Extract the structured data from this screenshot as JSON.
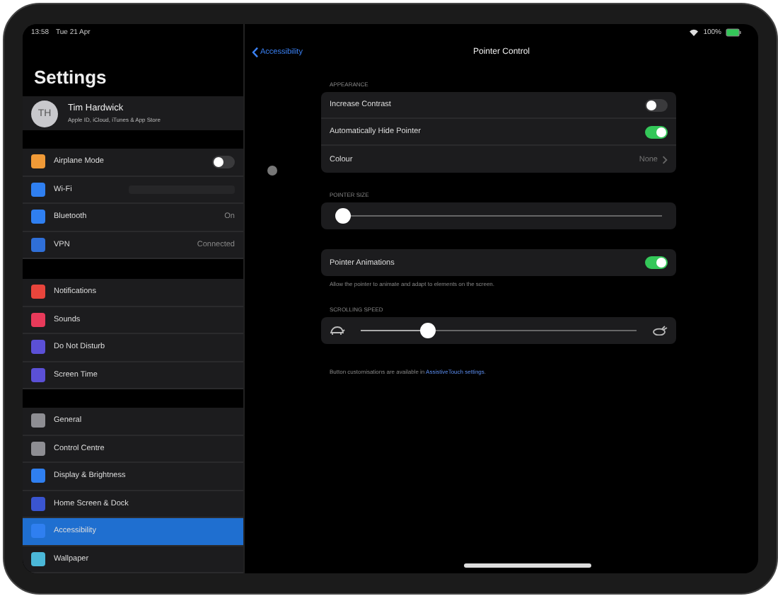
{
  "status_bar": {
    "time": "13:58",
    "date": "Tue 21 Apr",
    "battery": "100%"
  },
  "sidebar": {
    "title": "Settings",
    "profile": {
      "initials": "TH",
      "name": "Tim Hardwick",
      "subtitle": "Apple ID, iCloud, iTunes & App Store"
    },
    "groups": [
      [
        {
          "label": "Airplane Mode",
          "kind": "toggle",
          "on": false,
          "color": "#f09a37",
          "selected": false
        },
        {
          "label": "Wi-Fi",
          "kind": "blurred",
          "color": "#2f7ff0",
          "selected": false
        },
        {
          "label": "Bluetooth",
          "kind": "value",
          "value": "On",
          "color": "#2f7ff0",
          "selected": false
        },
        {
          "label": "VPN",
          "kind": "value",
          "value": "Connected",
          "color": "#2f6fd8",
          "selected": false
        }
      ],
      [
        {
          "label": "Notifications",
          "kind": "plain",
          "color": "#e8453c",
          "selected": false
        },
        {
          "label": "Sounds",
          "kind": "plain",
          "color": "#e83a5a",
          "selected": false
        },
        {
          "label": "Do Not Disturb",
          "kind": "plain",
          "color": "#5b50d6",
          "selected": false
        },
        {
          "label": "Screen Time",
          "kind": "plain",
          "color": "#5b50d6",
          "selected": false
        }
      ],
      [
        {
          "label": "General",
          "kind": "plain",
          "color": "#8e8e93",
          "selected": false
        },
        {
          "label": "Control Centre",
          "kind": "plain",
          "color": "#8e8e93",
          "selected": false
        },
        {
          "label": "Display & Brightness",
          "kind": "plain",
          "color": "#2f7ff0",
          "selected": false
        },
        {
          "label": "Home Screen & Dock",
          "kind": "plain",
          "color": "#3a55d0",
          "selected": false
        },
        {
          "label": "Accessibility",
          "kind": "plain",
          "color": "#2f7ff0",
          "selected": true
        },
        {
          "label": "Wallpaper",
          "kind": "plain",
          "color": "#4bb8d8",
          "selected": false
        }
      ]
    ]
  },
  "detail": {
    "back": "Accessibility",
    "title": "Pointer Control",
    "sections": [
      {
        "header": "APPEARANCE",
        "rows": [
          {
            "kind": "toggle",
            "label": "Increase Contrast",
            "on": false
          },
          {
            "kind": "toggle",
            "label": "Automatically Hide Pointer",
            "on": true
          },
          {
            "kind": "value",
            "label": "Colour",
            "value": "None"
          }
        ]
      },
      {
        "header": "POINTER SIZE",
        "rows": [
          {
            "kind": "slider",
            "level": 0
          }
        ]
      },
      {
        "rows": [
          {
            "kind": "toggle",
            "label": "Pointer Animations",
            "on": true
          }
        ],
        "footer": "Allow the pointer to animate and adapt to elements on the screen."
      },
      {
        "header": "SCROLLING SPEED",
        "rows": [
          {
            "kind": "speed-slider",
            "level": 0.23
          }
        ]
      }
    ],
    "note": "Button customisations are available in ",
    "note_link": "AssistiveTouch settings",
    "note_end": "."
  }
}
